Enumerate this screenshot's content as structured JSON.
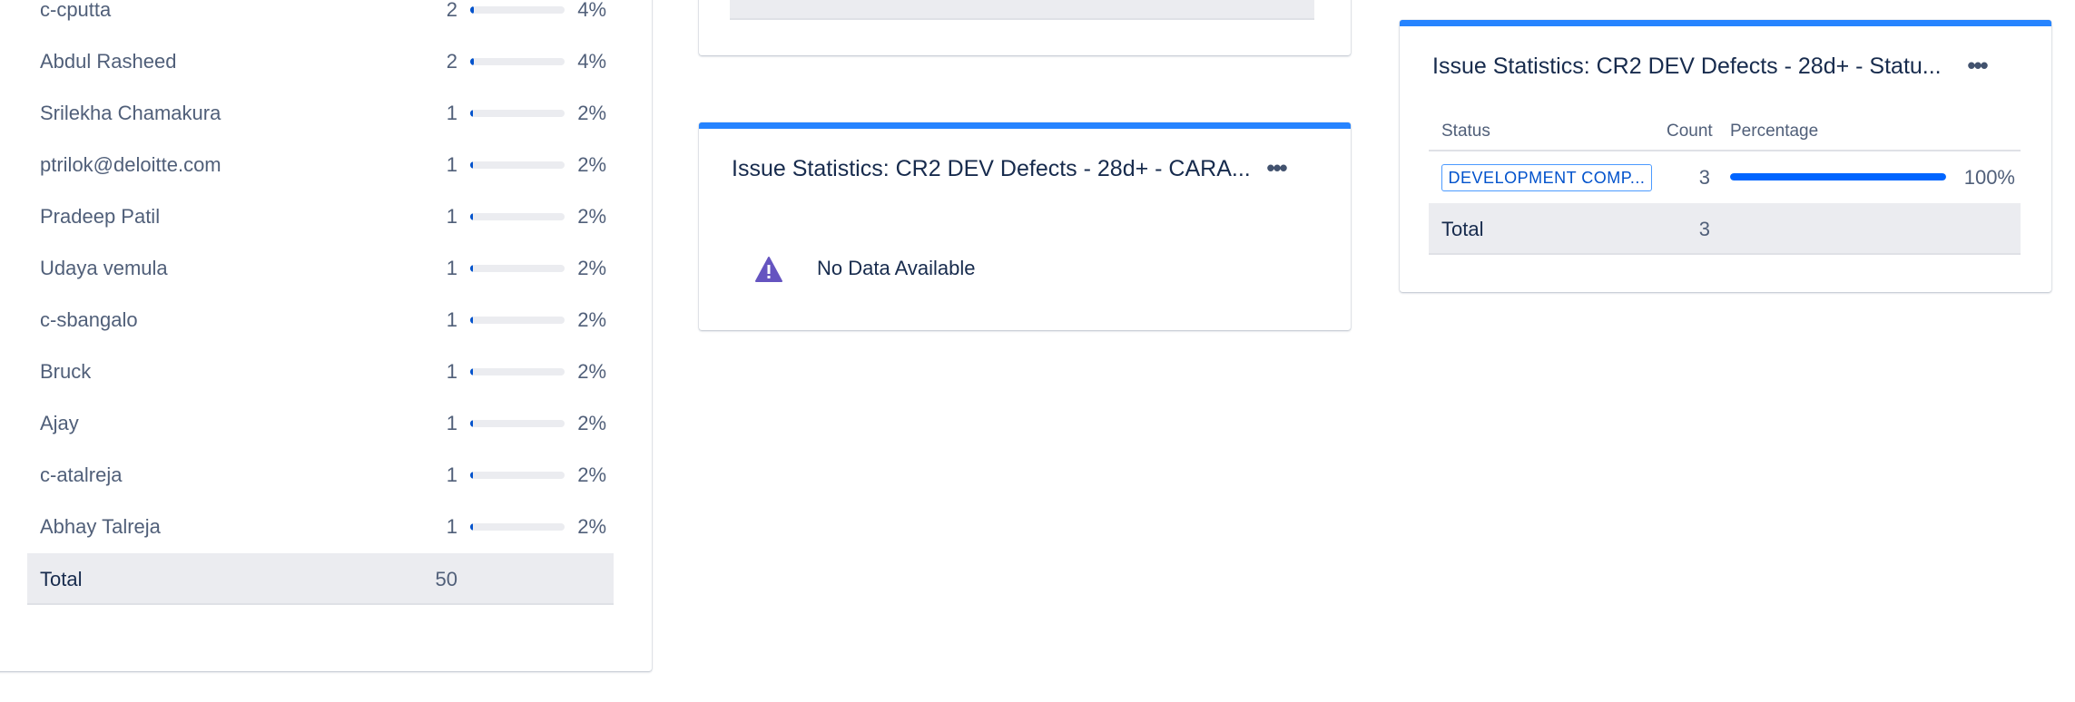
{
  "colors": {
    "accent": "#2684ff",
    "bar_fill": "#0052cc",
    "bar_track": "#ebecf0",
    "warning_icon": "#6554c0",
    "lozenge_border": "#4c9aff"
  },
  "left_table": {
    "rows": [
      {
        "name": "c-cputta",
        "count": "2",
        "percent": "4%",
        "fraction": 0.04
      },
      {
        "name": "Abdul Rasheed",
        "count": "2",
        "percent": "4%",
        "fraction": 0.04
      },
      {
        "name": "Srilekha Chamakura",
        "count": "1",
        "percent": "2%",
        "fraction": 0.02
      },
      {
        "name": "ptrilok@deloitte.com",
        "count": "1",
        "percent": "2%",
        "fraction": 0.02
      },
      {
        "name": "Pradeep Patil",
        "count": "1",
        "percent": "2%",
        "fraction": 0.02
      },
      {
        "name": "Udaya vemula",
        "count": "1",
        "percent": "2%",
        "fraction": 0.02
      },
      {
        "name": "c-sbangalo",
        "count": "1",
        "percent": "2%",
        "fraction": 0.02
      },
      {
        "name": "Bruck",
        "count": "1",
        "percent": "2%",
        "fraction": 0.02
      },
      {
        "name": "Ajay",
        "count": "1",
        "percent": "2%",
        "fraction": 0.02
      },
      {
        "name": "c-atalreja",
        "count": "1",
        "percent": "2%",
        "fraction": 0.02
      },
      {
        "name": "Abhay Talreja",
        "count": "1",
        "percent": "2%",
        "fraction": 0.02
      }
    ],
    "total_label": "Total",
    "total_count": "50"
  },
  "middle_gadget": {
    "title": "Issue Statistics: CR2 DEV Defects - 28d+ - CARA...",
    "menu_icon": "more-horizontal-icon",
    "warning_icon": "warning-icon",
    "message": "No Data Available"
  },
  "right_gadget": {
    "title": "Issue Statistics: CR2 DEV Defects - 28d+ - Statu...",
    "menu_icon": "more-horizontal-icon",
    "headers": {
      "status": "Status",
      "count": "Count",
      "percentage": "Percentage"
    },
    "row": {
      "status": "DEVELOPMENT COMP...",
      "count": "3",
      "percent": "100%",
      "fraction": 1.0
    },
    "total_label": "Total",
    "total_count": "3"
  }
}
